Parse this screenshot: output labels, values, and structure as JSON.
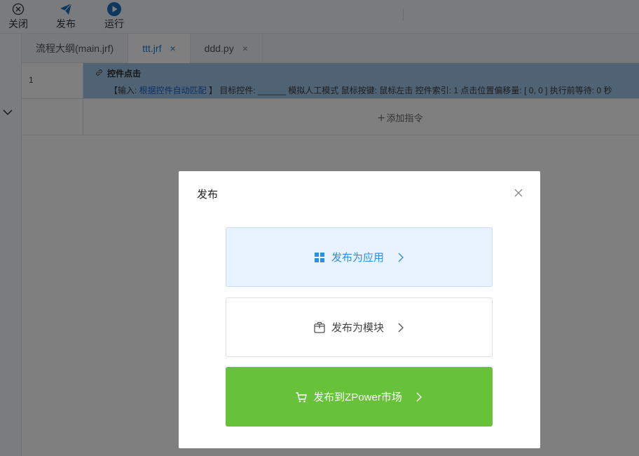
{
  "toolbar": {
    "close_label": "关闭",
    "publish_label": "发布",
    "run_label": "运行"
  },
  "tabs": [
    {
      "label": "流程大纲(main.jrf)",
      "closable": false,
      "active": false
    },
    {
      "label": "ttt.jrf",
      "closable": true,
      "active": true
    },
    {
      "label": "ddd.py",
      "closable": true,
      "active": false
    }
  ],
  "tab_close_glyph": "×",
  "editor": {
    "row1": {
      "line_number": "1",
      "title": "控件点击",
      "params_prefix": "【输入: ",
      "params_link": "根据控件自动匹配",
      "params_rest": " 】 目标控件: ______ 模拟人工模式 鼠标按键: 鼠标左击 控件索引: 1 点击位置偏移量: [ 0, 0 ] 执行前等待: 0 秒"
    },
    "add_command": "添加指令",
    "add_plus": "+"
  },
  "dialog": {
    "title": "发布",
    "options": {
      "app": "发布为应用",
      "module": "发布为模块",
      "market": "发布到ZPower市场"
    }
  },
  "colors": {
    "accent_blue": "#2f8ee3",
    "market_green": "#67c23a",
    "row_highlight": "#9fc6ea"
  }
}
